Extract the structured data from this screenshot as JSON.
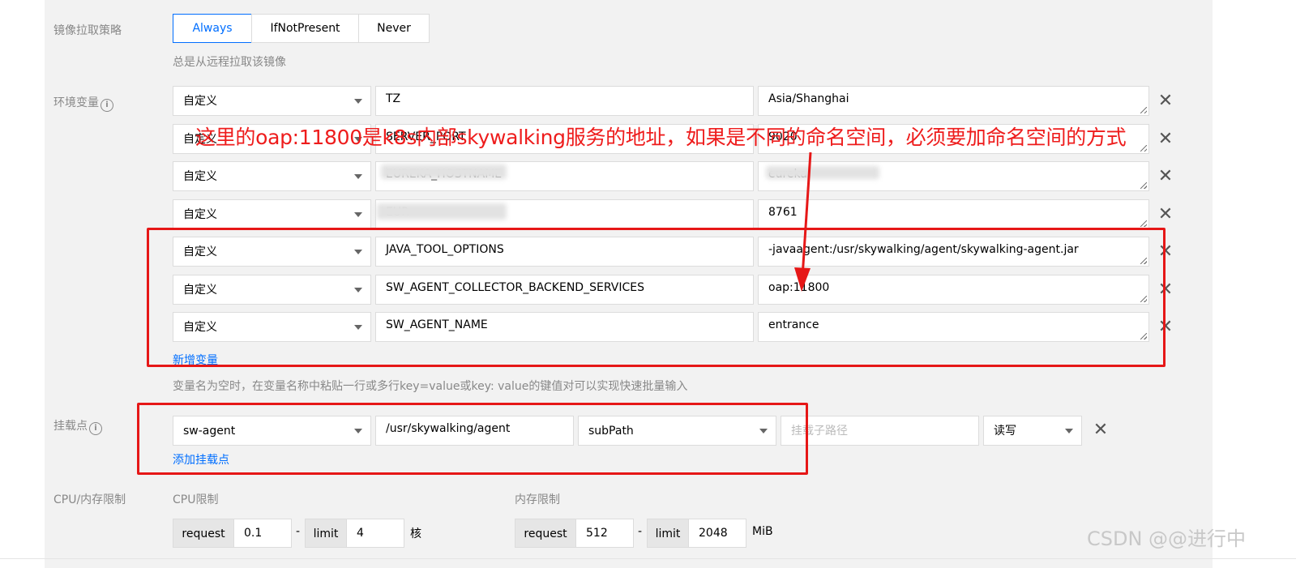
{
  "pull_policy": {
    "label": "镜像拉取策略",
    "options": [
      "Always",
      "IfNotPresent",
      "Never"
    ],
    "selected": "Always",
    "hint": "总是从远程拉取该镜像"
  },
  "env": {
    "label": "环境变量",
    "rows": [
      {
        "type": "自定义",
        "name": "TZ",
        "value": "Asia/Shanghai"
      },
      {
        "type": "自定义",
        "name": "SERVER_PORT",
        "value": "9020"
      },
      {
        "type": "自定义",
        "name": "EUREKA_HOSTNAME",
        "value": "eureka"
      },
      {
        "type": "自定义",
        "name": "EUR",
        "value": "8761"
      },
      {
        "type": "自定义",
        "name": "JAVA_TOOL_OPTIONS",
        "value": "-javaagent:/usr/skywalking/agent/skywalking-agent.jar"
      },
      {
        "type": "自定义",
        "name": "SW_AGENT_COLLECTOR_BACKEND_SERVICES",
        "value": "oap:11800"
      },
      {
        "type": "自定义",
        "name": "SW_AGENT_NAME",
        "value": "entrance"
      }
    ],
    "add_link": "新增变量",
    "hint": "变量名为空时，在变量名称中粘贴一行或多行key=value或key: value的键值对可以实现快速批量输入"
  },
  "annotation": "这里的oap:11800是k8s内部skywalking服务的地址，如果是不同的命名空间，必须要加命名空间的方式",
  "mount": {
    "label": "挂载点",
    "volume": "sw-agent",
    "path": "/usr/skywalking/agent",
    "subpath_mode": "subPath",
    "subpath_placeholder": "挂载子路径",
    "mode": "读写",
    "add_link": "添加挂载点"
  },
  "resources": {
    "label": "CPU/内存限制",
    "cpu": {
      "title": "CPU限制",
      "request_label": "request",
      "request": "0.1",
      "limit_label": "limit",
      "limit": "4",
      "unit": "核"
    },
    "memory": {
      "title": "内存限制",
      "request_label": "request",
      "request": "512",
      "limit_label": "limit",
      "limit": "2048",
      "unit": "MiB"
    },
    "dash": "-"
  },
  "watermark": "CSDN @@进行中",
  "colors": {
    "accent": "#006eff",
    "annotation_red": "#e61717"
  }
}
